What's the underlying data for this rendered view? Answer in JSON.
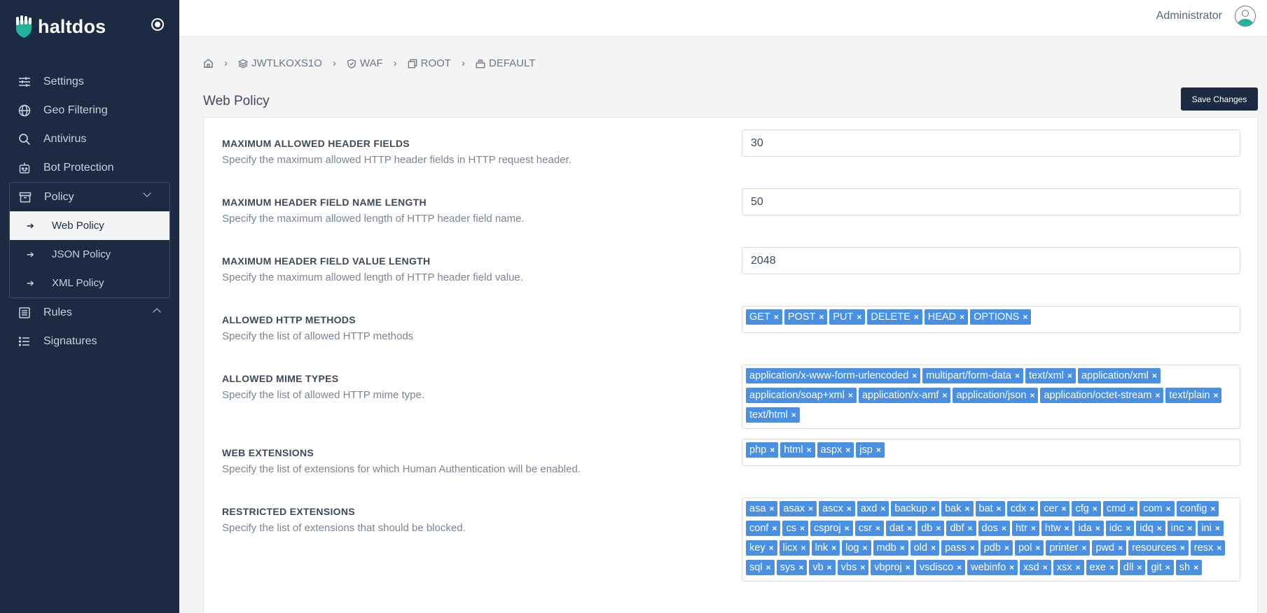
{
  "app": {
    "brand": "haltdos",
    "admin": "Administrator"
  },
  "sidebar": {
    "items": [
      {
        "label": "Settings",
        "icon": "sliders-icon"
      },
      {
        "label": "Geo Filtering",
        "icon": "globe-icon"
      },
      {
        "label": "Antivirus",
        "icon": "search-icon"
      },
      {
        "label": "Bot Protection",
        "icon": "robot-icon"
      },
      {
        "label": "Policy",
        "icon": "archive-icon"
      },
      {
        "label": "Rules",
        "icon": "list-icon"
      },
      {
        "label": "Signatures",
        "icon": "bullets-icon"
      }
    ],
    "policy_sub": [
      "Web Policy",
      "JSON Policy",
      "XML Policy"
    ]
  },
  "breadcrumb": [
    "JWTLKOXS1O",
    "WAF",
    "ROOT",
    "DEFAULT"
  ],
  "page": {
    "title": "Web Policy",
    "save_label": "Save Changes"
  },
  "settings": {
    "max_header_fields": {
      "label": "MAXIMUM ALLOWED HEADER FIELDS",
      "desc": "Specify the maximum allowed HTTP header fields in HTTP request header.",
      "value": "30"
    },
    "max_name_len": {
      "label": "MAXIMUM HEADER FIELD NAME LENGTH",
      "desc": "Specify the maximum allowed length of HTTP header field name.",
      "value": "50"
    },
    "max_value_len": {
      "label": "MAXIMUM HEADER FIELD VALUE LENGTH",
      "desc": "Specify the maximum allowed length of HTTP header field value.",
      "value": "2048"
    },
    "methods": {
      "label": "ALLOWED HTTP METHODS",
      "desc": "Specify the list of allowed HTTP methods",
      "tags": [
        "GET",
        "POST",
        "PUT",
        "DELETE",
        "HEAD",
        "OPTIONS"
      ]
    },
    "mime": {
      "label": "ALLOWED MIME TYPES",
      "desc": "Specify the list of allowed HTTP mime type.",
      "tags": [
        "application/x-www-form-urlencoded",
        "multipart/form-data",
        "text/xml",
        "application/xml",
        "application/soap+xml",
        "application/x-amf",
        "application/json",
        "application/octet-stream",
        "text/plain",
        "text/html"
      ]
    },
    "web_ext": {
      "label": "WEB EXTENSIONS",
      "desc": "Specify the list of extensions for which Human Authentication will be enabled.",
      "tags": [
        "php",
        "html",
        "aspx",
        "jsp"
      ]
    },
    "restricted_ext": {
      "label": "RESTRICTED EXTENSIONS",
      "desc": "Specify the list of extensions that should be blocked.",
      "tags": [
        "asa",
        "asax",
        "ascx",
        "axd",
        "backup",
        "bak",
        "bat",
        "cdx",
        "cer",
        "cfg",
        "cmd",
        "com",
        "config",
        "conf",
        "cs",
        "csproj",
        "csr",
        "dat",
        "db",
        "dbf",
        "dos",
        "htr",
        "htw",
        "ida",
        "idc",
        "idq",
        "inc",
        "ini",
        "key",
        "licx",
        "lnk",
        "log",
        "mdb",
        "old",
        "pass",
        "pdb",
        "pol",
        "printer",
        "pwd",
        "resources",
        "resx",
        "sql",
        "sys",
        "vb",
        "vbs",
        "vbproj",
        "vsdisco",
        "webinfo",
        "xsd",
        "xsx",
        "exe",
        "dll",
        "git",
        "sh"
      ]
    }
  },
  "colors": {
    "sidebar_bg": "#1d2a44",
    "tag_bg": "#4a90e2",
    "accent": "#22b39a"
  }
}
